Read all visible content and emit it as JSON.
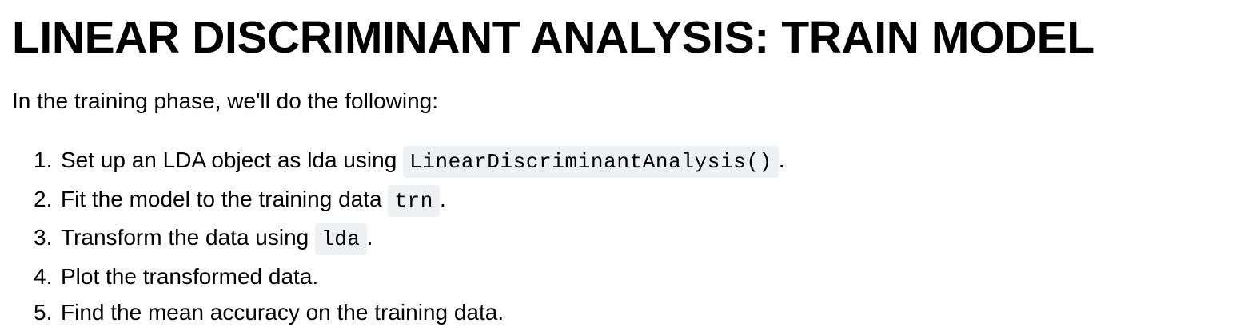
{
  "title": "LINEAR DISCRIMINANT ANALYSIS: TRAIN MODEL",
  "intro": "In the training phase, we'll do the following:",
  "steps": [
    {
      "num": "1.",
      "before": "Set up an LDA object as lda using ",
      "code": "LinearDiscriminantAnalysis()",
      "after": "."
    },
    {
      "num": "2.",
      "before": "Fit the model to the training data ",
      "code": "trn",
      "after": "."
    },
    {
      "num": "3.",
      "before": "Transform the data using ",
      "code": "lda",
      "after": "."
    },
    {
      "num": "4.",
      "before": "Plot the transformed data.",
      "code": "",
      "after": ""
    },
    {
      "num": "5.",
      "before": "Find the mean accuracy on the training data.",
      "code": "",
      "after": ""
    }
  ]
}
